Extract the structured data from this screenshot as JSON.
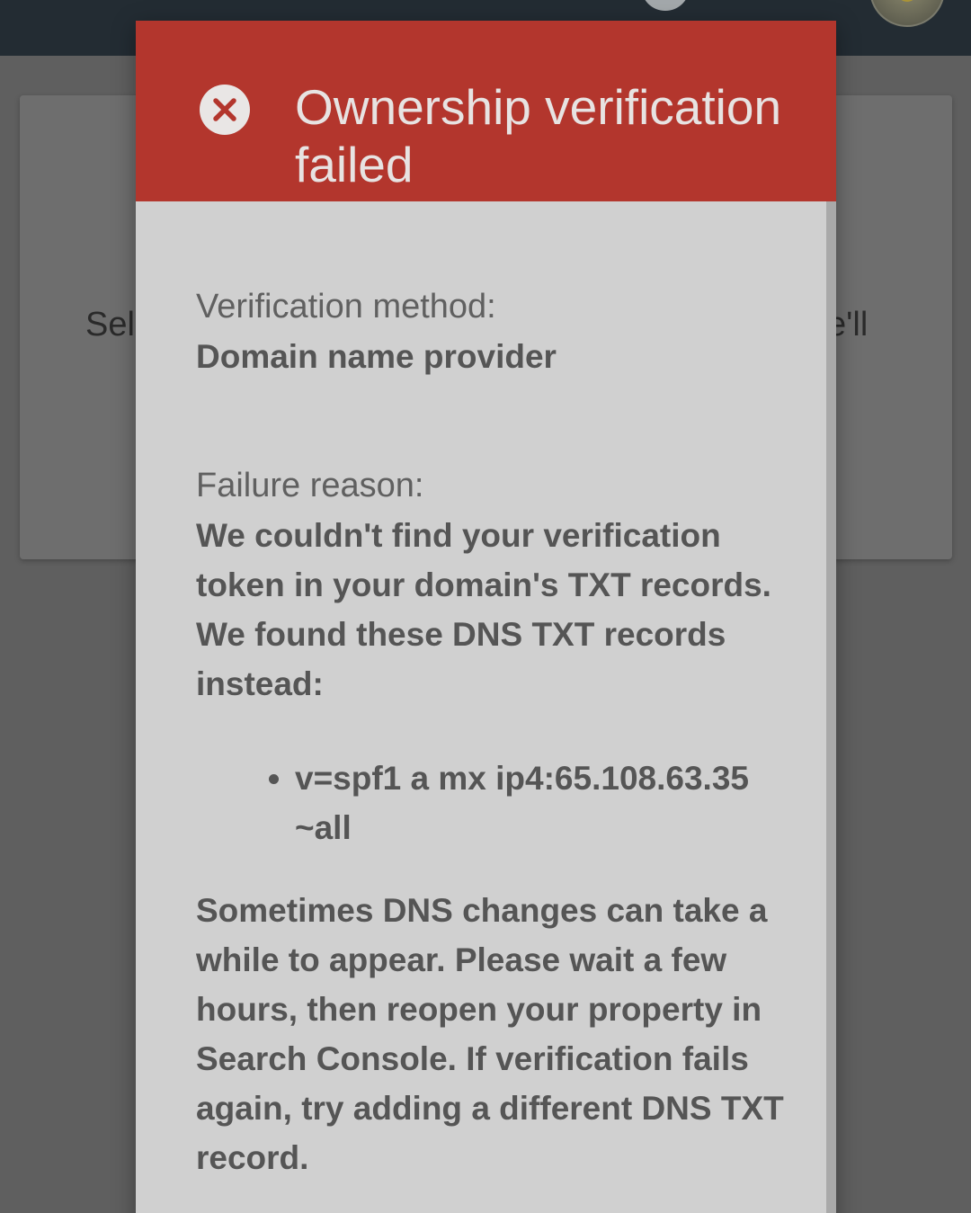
{
  "background": {
    "card_text_left": "Sel",
    "card_text_right": "e'll"
  },
  "dialog": {
    "title": "Ownership verification failed",
    "method_label": "Verification method:",
    "method_value": "Domain name provider",
    "reason_label": "Failure reason:",
    "reason_text": "We couldn't find your verification token in your domain's TXT records. We found these DNS TXT records instead:",
    "records": [
      "v=spf1 a mx ip4:65.108.63.35 ~all"
    ],
    "advice": "Sometimes DNS changes can take a while to appear. Please wait a few hours, then reopen your property in Search Console. If verification fails again, try adding a different DNS TXT record."
  },
  "icons": {
    "error": "error-circle-icon",
    "menu": "menu-icon",
    "help": "help-icon",
    "settings": "settings-icon",
    "avatar": "avatar"
  },
  "colors": {
    "header_red": "#b3362d",
    "dialog_bg": "#d0d0d0",
    "overlay_bg": "#5f5f5f",
    "appbar_bg": "#232c33"
  }
}
